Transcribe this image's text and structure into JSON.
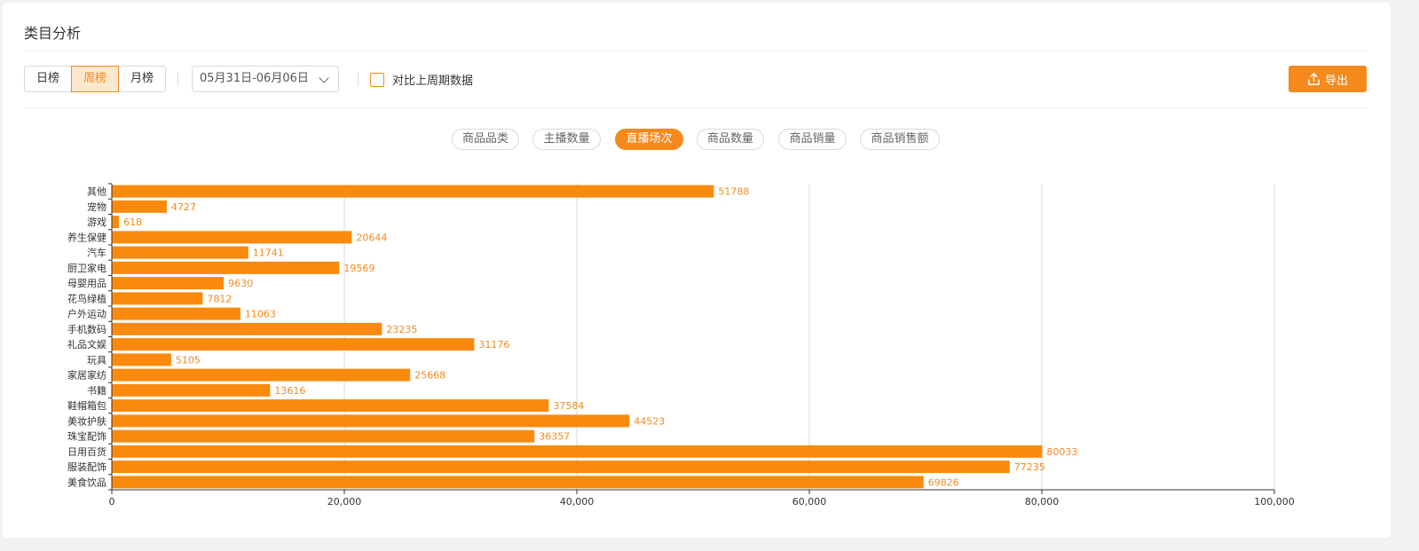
{
  "header": {
    "title": "类目分析"
  },
  "toolbar": {
    "periods": [
      {
        "label": "日榜",
        "active": false
      },
      {
        "label": "周榜",
        "active": true
      },
      {
        "label": "月榜",
        "active": false
      }
    ],
    "date_range": "05月31日-06月06日",
    "compare_label": "对比上周期数据",
    "compare_checked": false,
    "export_label": "导出"
  },
  "metrics": {
    "tabs": [
      {
        "label": "商品品类",
        "active": false
      },
      {
        "label": "主播数量",
        "active": false
      },
      {
        "label": "直播场次",
        "active": true
      },
      {
        "label": "商品数量",
        "active": false
      },
      {
        "label": "商品销量",
        "active": false
      },
      {
        "label": "商品销售额",
        "active": false
      }
    ]
  },
  "colors": {
    "accent": "#f5891c",
    "bar": "#f98a0d",
    "grid": "#d9d9d9",
    "axis": "#333333"
  },
  "chart_data": {
    "type": "bar",
    "orientation": "horizontal",
    "categories": [
      "其他",
      "宠物",
      "游戏",
      "养生保健",
      "汽车",
      "厨卫家电",
      "母婴用品",
      "花鸟绿植",
      "户外运动",
      "手机数码",
      "礼品文娱",
      "玩具",
      "家居家纺",
      "书籍",
      "鞋帽箱包",
      "美妆护肤",
      "珠宝配饰",
      "日用百货",
      "服装配饰",
      "美食饮品"
    ],
    "values": [
      51788,
      4727,
      618,
      20644,
      11741,
      19569,
      9630,
      7812,
      11063,
      23235,
      31176,
      5105,
      25668,
      13616,
      37584,
      44523,
      36357,
      80033,
      77235,
      69826
    ],
    "value_labels": [
      "51788",
      "4727",
      "618",
      "20644",
      "11741",
      "19569",
      "9630",
      "7812",
      "11063",
      "23235",
      "31176",
      "5105",
      "25668",
      "13616",
      "37584",
      "44523",
      "36357",
      "80033",
      "77235",
      "69826"
    ],
    "xlim": [
      0,
      100000
    ],
    "x_ticks": [
      0,
      20000,
      40000,
      60000,
      80000,
      100000
    ],
    "x_tick_labels": [
      "0",
      "20,000",
      "40,000",
      "60,000",
      "80,000",
      "100,000"
    ],
    "grid": true,
    "data_labels": true,
    "title": "",
    "xlabel": "",
    "ylabel": ""
  }
}
